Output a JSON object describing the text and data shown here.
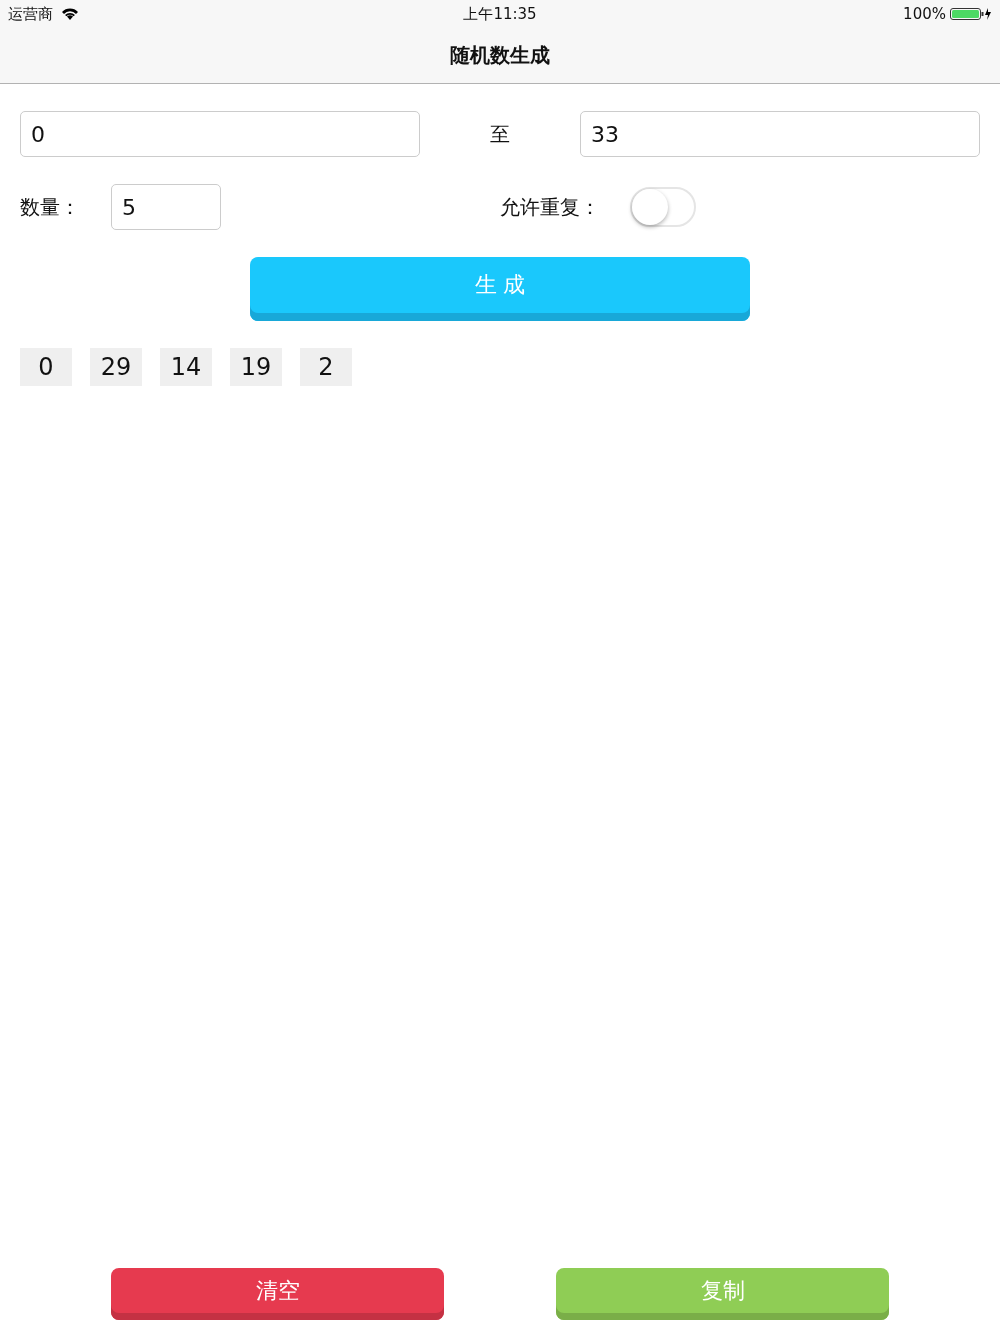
{
  "status_bar": {
    "carrier": "运营商",
    "time": "上午11:35",
    "battery": "100%"
  },
  "nav": {
    "title": "随机数生成"
  },
  "range": {
    "from": {
      "value": "0"
    },
    "separator": "至",
    "to": {
      "value": "33"
    }
  },
  "count": {
    "label": "数量：",
    "value": "5"
  },
  "allow_repeat": {
    "label": "允许重复：",
    "on": false
  },
  "generate_button": "生 成",
  "results": [
    "0",
    "29",
    "14",
    "19",
    "2"
  ],
  "buttons": [
    {
      "label": "清空",
      "color": "#e63a4f"
    },
    {
      "label": "复制",
      "color": "#8fcd55"
    }
  ]
}
